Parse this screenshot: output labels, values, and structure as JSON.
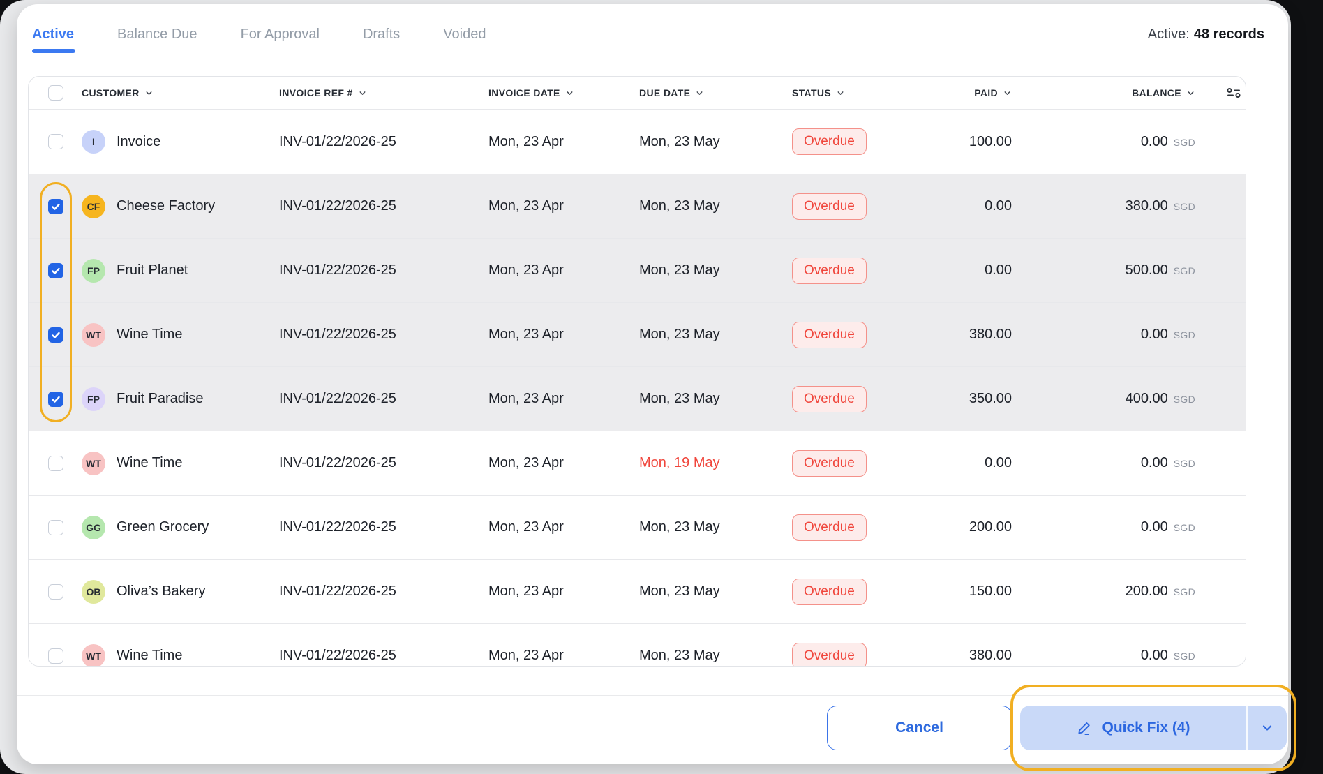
{
  "tab_bar": {
    "tabs": [
      {
        "label": "Active",
        "active": true
      },
      {
        "label": "Balance Due",
        "active": false
      },
      {
        "label": "For Approval",
        "active": false
      },
      {
        "label": "Drafts",
        "active": false
      },
      {
        "label": "Voided",
        "active": false
      }
    ],
    "summary_prefix": "Active:",
    "summary_value": "48 records"
  },
  "table": {
    "columns": [
      {
        "label": "CUSTOMER"
      },
      {
        "label": "INVOICE REF #"
      },
      {
        "label": "INVOICE DATE"
      },
      {
        "label": "DUE DATE"
      },
      {
        "label": "STATUS"
      },
      {
        "label": "PAID"
      },
      {
        "label": "BALANCE"
      }
    ],
    "rows": [
      {
        "customer": "Invoice",
        "initials": "I",
        "avatar_bg": "#c7d2f9",
        "invoice_ref": "INV-01/22/2026-25",
        "invoice_date": "Mon, 23 Apr",
        "due_date": "Mon, 23 May",
        "due_date_alert": false,
        "status": "Overdue",
        "paid": "100.00",
        "balance": "0.00",
        "currency": "SGD",
        "checked": false
      },
      {
        "customer": "Cheese Factory",
        "initials": "CF",
        "avatar_bg": "#f6b51f",
        "invoice_ref": "INV-01/22/2026-25",
        "invoice_date": "Mon, 23 Apr",
        "due_date": "Mon, 23 May",
        "due_date_alert": false,
        "status": "Overdue",
        "paid": "0.00",
        "balance": "380.00",
        "currency": "SGD",
        "checked": true
      },
      {
        "customer": "Fruit Planet",
        "initials": "FP",
        "avatar_bg": "#b5e7ae",
        "invoice_ref": "INV-01/22/2026-25",
        "invoice_date": "Mon, 23 Apr",
        "due_date": "Mon, 23 May",
        "due_date_alert": false,
        "status": "Overdue",
        "paid": "0.00",
        "balance": "500.00",
        "currency": "SGD",
        "checked": true
      },
      {
        "customer": "Wine Time",
        "initials": "WT",
        "avatar_bg": "#f8c3c3",
        "invoice_ref": "INV-01/22/2026-25",
        "invoice_date": "Mon, 23 Apr",
        "due_date": "Mon, 23 May",
        "due_date_alert": false,
        "status": "Overdue",
        "paid": "380.00",
        "balance": "0.00",
        "currency": "SGD",
        "checked": true
      },
      {
        "customer": "Fruit Paradise",
        "initials": "FP",
        "avatar_bg": "#dcd4f9",
        "invoice_ref": "INV-01/22/2026-25",
        "invoice_date": "Mon, 23 Apr",
        "due_date": "Mon, 23 May",
        "due_date_alert": false,
        "status": "Overdue",
        "paid": "350.00",
        "balance": "400.00",
        "currency": "SGD",
        "checked": true
      },
      {
        "customer": "Wine Time",
        "initials": "WT",
        "avatar_bg": "#f8c3c3",
        "invoice_ref": "INV-01/22/2026-25",
        "invoice_date": "Mon, 23 Apr",
        "due_date": "Mon, 19 May",
        "due_date_alert": true,
        "status": "Overdue",
        "paid": "0.00",
        "balance": "0.00",
        "currency": "SGD",
        "checked": false
      },
      {
        "customer": "Green Grocery",
        "initials": "GG",
        "avatar_bg": "#b5e7ae",
        "invoice_ref": "INV-01/22/2026-25",
        "invoice_date": "Mon, 23 Apr",
        "due_date": "Mon, 23 May",
        "due_date_alert": false,
        "status": "Overdue",
        "paid": "200.00",
        "balance": "0.00",
        "currency": "SGD",
        "checked": false
      },
      {
        "customer": "Oliva’s Bakery",
        "initials": "OB",
        "avatar_bg": "#e0e89c",
        "invoice_ref": "INV-01/22/2026-25",
        "invoice_date": "Mon, 23 Apr",
        "due_date": "Mon, 23 May",
        "due_date_alert": false,
        "status": "Overdue",
        "paid": "150.00",
        "balance": "200.00",
        "currency": "SGD",
        "checked": false
      },
      {
        "customer": "Wine Time",
        "initials": "WT",
        "avatar_bg": "#f8c3c3",
        "invoice_ref": "INV-01/22/2026-25",
        "invoice_date": "Mon, 23 Apr",
        "due_date": "Mon, 23 May",
        "due_date_alert": false,
        "status": "Overdue",
        "paid": "380.00",
        "balance": "0.00",
        "currency": "SGD",
        "checked": false
      }
    ]
  },
  "footer": {
    "cancel_label": "Cancel",
    "quick_fix_label": "Quick Fix (4)"
  },
  "colors": {
    "accent_blue": "#3b79f1",
    "checkbox_blue": "#2264e5",
    "highlight_orange": "#f1af22",
    "overdue_red": "#f0463c",
    "overdue_bg": "#fdeceb",
    "selected_row_bg": "#ececee"
  }
}
